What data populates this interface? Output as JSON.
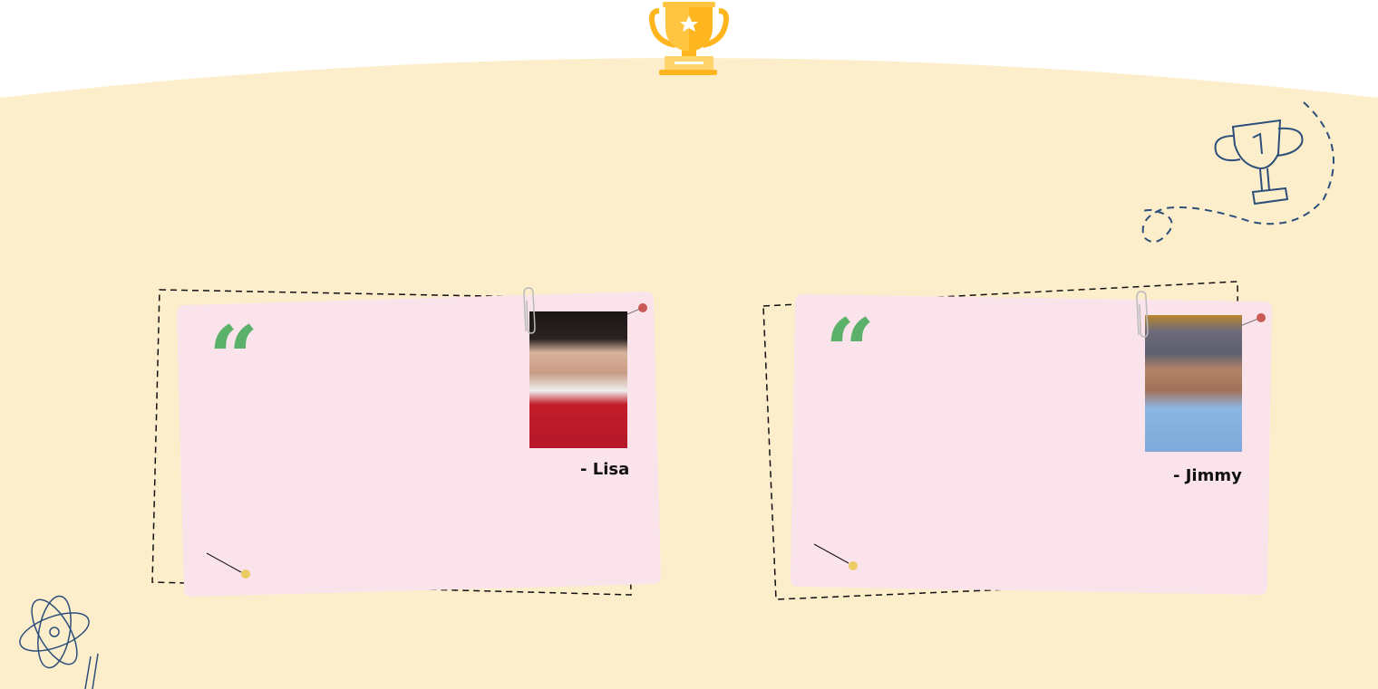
{
  "colors": {
    "background": "#fdeecb",
    "card": "#fae3ea",
    "quote": "#5bb06a",
    "pin_red": "#c85a58",
    "pin_yellow": "#eccb62",
    "doodle": "#2b4f7a",
    "trophy": "#ffc440"
  },
  "icons": {
    "trophy": "trophy-icon",
    "doodle_trophy": "trophy-doodle-icon",
    "atom": "atom-icon",
    "quote": "quote-icon",
    "paperclip": "paperclip-icon",
    "pin": "pin-icon"
  },
  "testimonials": [
    {
      "name": "- Lisa",
      "quote_mark": "“"
    },
    {
      "name": "- Jimmy",
      "quote_mark": "“"
    }
  ]
}
